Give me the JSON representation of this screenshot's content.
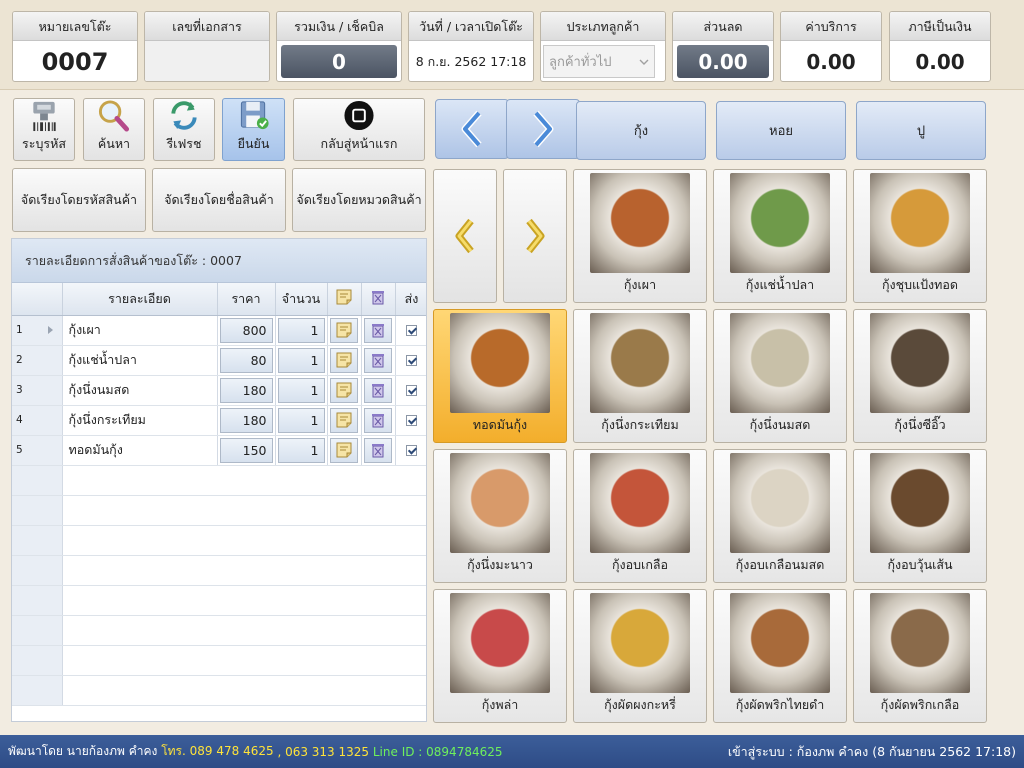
{
  "header": {
    "table_no": {
      "label": "หมายเลขโต๊ะ",
      "value": "0007"
    },
    "doc_no": {
      "label": "เลขที่เอกสาร",
      "value": ""
    },
    "total": {
      "label": "รวมเงิน / เช็คบิล",
      "value": "0"
    },
    "datetime": {
      "label": "วันที่ / เวลาเปิดโต๊ะ",
      "value": "8 ก.ย. 2562 17:18"
    },
    "customer_type": {
      "label": "ประเภทลูกค้า",
      "value": "ลูกค้าทั่วไป"
    },
    "discount": {
      "label": "ส่วนลด",
      "value": "0.00"
    },
    "service": {
      "label": "ค่าบริการ",
      "value": "0.00"
    },
    "tax": {
      "label": "ภาษีเป็นเงิน",
      "value": "0.00"
    }
  },
  "toolbar": {
    "barcode": "ระบุรหัส",
    "search": "ค้นหา",
    "refresh": "รีเฟรช",
    "confirm": "ยืนยัน",
    "home": "กลับสู่หน้าแรก"
  },
  "sort": {
    "by_code": "จัดเรียงโดยรหัสสินค้า",
    "by_name": "จัดเรียงโดยชื่อสินค้า",
    "by_category": "จัดเรียงโดยหมวดสินค้า"
  },
  "order": {
    "title": "รายละเอียดการสั่งสินค้าของโต๊ะ : 0007",
    "columns": {
      "detail": "รายละเอียด",
      "price": "ราคา",
      "qty": "จำนวน",
      "send": "ส่ง"
    },
    "rows": [
      {
        "no": "1",
        "name": "กุ้งเผา",
        "price": "800",
        "qty": "1"
      },
      {
        "no": "2",
        "name": "กุ้งแช่น้ำปลา",
        "price": "80",
        "qty": "1"
      },
      {
        "no": "3",
        "name": "กุ้งนึ่งนมสด",
        "price": "180",
        "qty": "1"
      },
      {
        "no": "4",
        "name": "กุ้งนึ่งกระเทียม",
        "price": "180",
        "qty": "1"
      },
      {
        "no": "5",
        "name": "ทอดมันกุ้ง",
        "price": "150",
        "qty": "1"
      }
    ]
  },
  "categories": [
    "กุ้ง",
    "หอย",
    "ปู"
  ],
  "menu": [
    {
      "name": "กุ้งเผา",
      "color": "#b8622e"
    },
    {
      "name": "กุ้งแช่น้ำปลา",
      "color": "#6f9a4a"
    },
    {
      "name": "กุ้งชุบแป้งทอด",
      "color": "#d69a3a"
    },
    {
      "name": "ทอดมันกุ้ง",
      "color": "#b86a2a"
    },
    {
      "name": "กุ้งนึ่งกระเทียม",
      "color": "#9a7a4a"
    },
    {
      "name": "กุ้งนึ่งนมสด",
      "color": "#c8c0a8"
    },
    {
      "name": "กุ้งนึ่งซีอิ๊ว",
      "color": "#5a4a3a"
    },
    {
      "name": "กุ้งนึ่งมะนาว",
      "color": "#d89a6a"
    },
    {
      "name": "กุ้งอบเกลือ",
      "color": "#c4553a"
    },
    {
      "name": "กุ้งอบเกลือนมสด",
      "color": "#dcd4c4"
    },
    {
      "name": "กุ้งอบวุ้นเส้น",
      "color": "#6a4a2e"
    },
    {
      "name": "กุ้งพล่า",
      "color": "#c84a4a"
    },
    {
      "name": "กุ้งผัดผงกะหรี่",
      "color": "#d8a83a"
    },
    {
      "name": "กุ้งผัดพริกไทยดำ",
      "color": "#a86a3a"
    },
    {
      "name": "กุ้งผัดพริกเกลือ",
      "color": "#8a6a4a"
    }
  ],
  "status": {
    "dev": "พัฒนาโดย นายก้องภพ คำคง",
    "tel": "โทร. 089 478 4625",
    "tel2": ", 063 313 1325",
    "line": "Line ID : 0894784625",
    "login": "เข้าสู่ระบบ : ก้องภพ คำคง (8 กันยายน 2562 17:18)"
  }
}
